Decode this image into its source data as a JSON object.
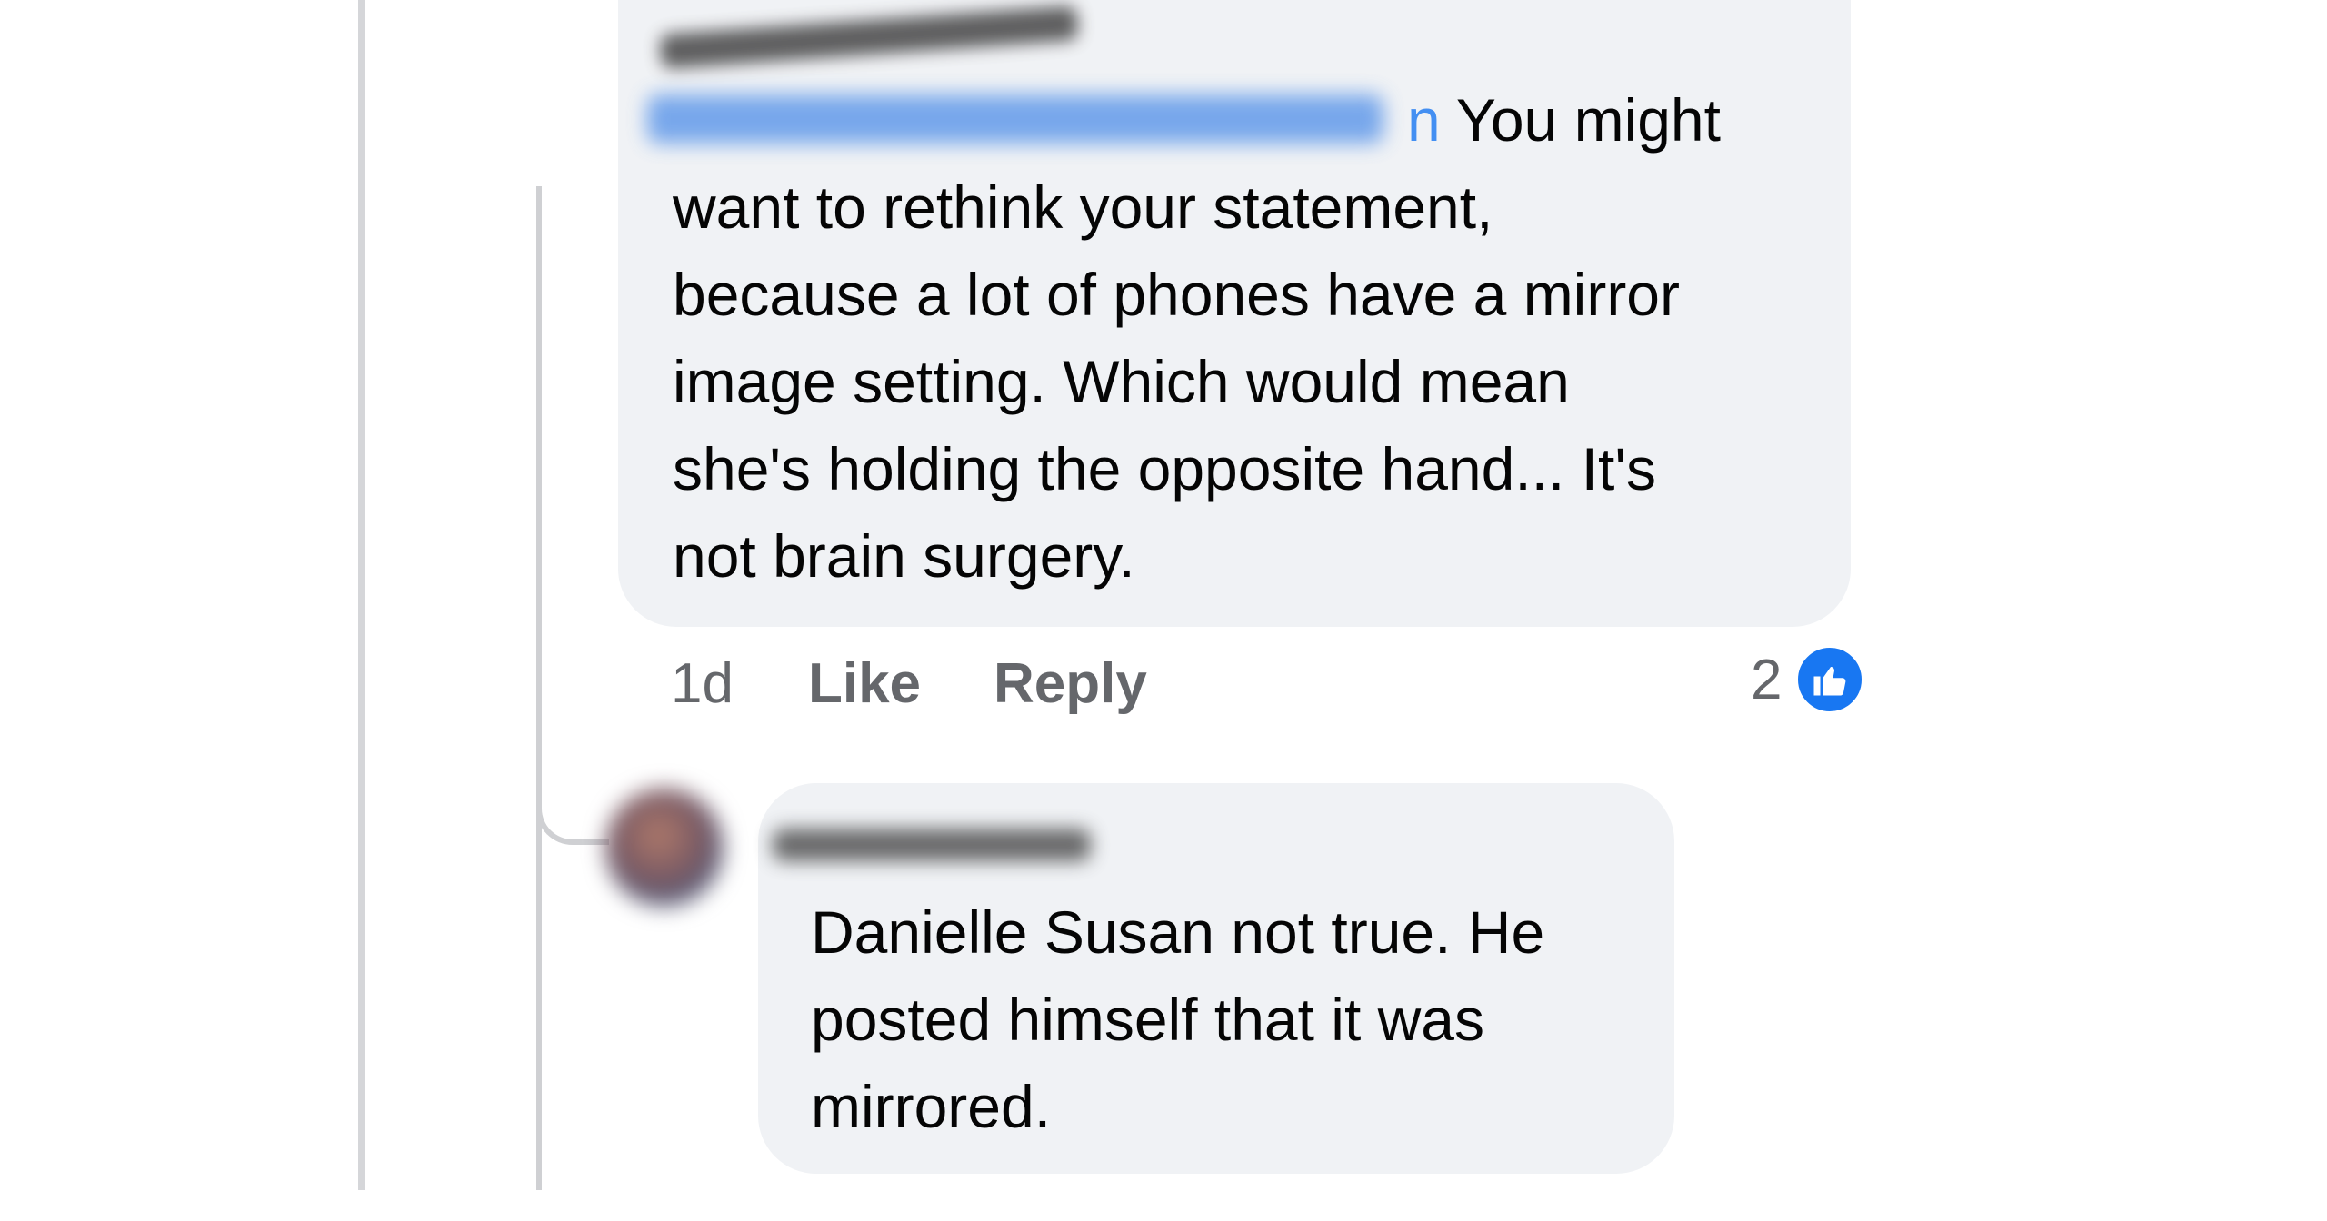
{
  "thread": {
    "comment_1": {
      "mention_visible_end": "n",
      "first_line": "You might",
      "body_lines": [
        "want to rethink your statement,",
        "because a lot of phones have a mirror",
        "image setting. Which would mean",
        "she's holding the opposite hand... It's",
        "not brain surgery."
      ],
      "time": "1d",
      "like_label": "Like",
      "reply_label": "Reply",
      "reaction_count": "2",
      "reaction_icon": "thumbs-up-icon",
      "reaction_color": "#1877f2"
    },
    "comment_2": {
      "body_lines": [
        "Danielle Susan not true. He",
        "posted himself that it was",
        "mirrored."
      ]
    }
  },
  "colors": {
    "bubble": "#f0f2f5",
    "text": "#050505",
    "muted": "#65676b",
    "link": "#1877f2"
  }
}
